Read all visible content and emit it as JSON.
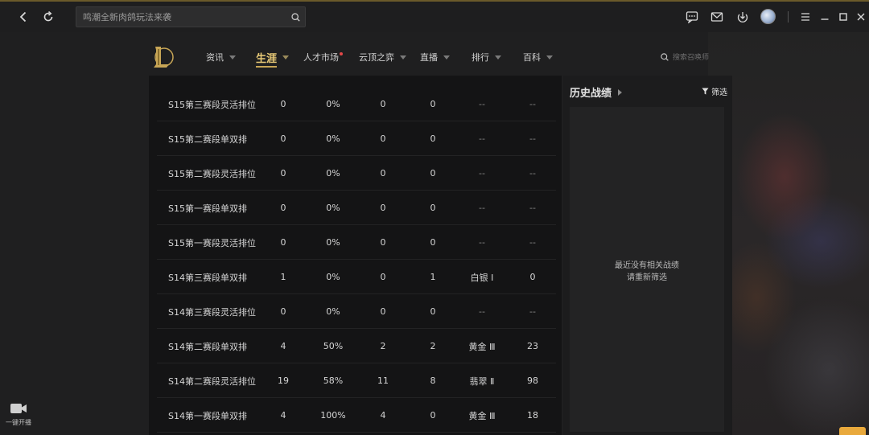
{
  "search": {
    "placeholder": "鸣潮全新肉鸽玩法来袭"
  },
  "nav": [
    {
      "label": "资讯",
      "has_caret": true,
      "active": false,
      "dot": false
    },
    {
      "label": "生涯",
      "has_caret": true,
      "active": true,
      "dot": false
    },
    {
      "label": "人才市场",
      "has_caret": false,
      "active": false,
      "dot": true
    },
    {
      "label": "云顶之弈",
      "has_caret": true,
      "active": false,
      "dot": false
    },
    {
      "label": "直播",
      "has_caret": true,
      "active": false,
      "dot": false
    },
    {
      "label": "排行",
      "has_caret": true,
      "active": false,
      "dot": false
    },
    {
      "label": "百科",
      "has_caret": true,
      "active": false,
      "dot": false
    }
  ],
  "summoner_search": {
    "placeholder": "搜索召唤师"
  },
  "table": {
    "rows": [
      [
        "S15第三赛段灵活排位",
        "0",
        "0%",
        "0",
        "0",
        "--",
        "--"
      ],
      [
        "S15第二赛段单双排",
        "0",
        "0%",
        "0",
        "0",
        "--",
        "--"
      ],
      [
        "S15第二赛段灵活排位",
        "0",
        "0%",
        "0",
        "0",
        "--",
        "--"
      ],
      [
        "S15第一赛段单双排",
        "0",
        "0%",
        "0",
        "0",
        "--",
        "--"
      ],
      [
        "S15第一赛段灵活排位",
        "0",
        "0%",
        "0",
        "0",
        "--",
        "--"
      ],
      [
        "S14第三赛段单双排",
        "1",
        "0%",
        "0",
        "1",
        "白银 Ⅰ",
        "0"
      ],
      [
        "S14第三赛段灵活排位",
        "0",
        "0%",
        "0",
        "0",
        "--",
        "--"
      ],
      [
        "S14第二赛段单双排",
        "4",
        "50%",
        "2",
        "2",
        "黄金 Ⅲ",
        "23"
      ],
      [
        "S14第二赛段灵活排位",
        "19",
        "58%",
        "11",
        "8",
        "翡翠 Ⅱ",
        "98"
      ],
      [
        "S14第一赛段单双排",
        "4",
        "100%",
        "4",
        "0",
        "黄金 Ⅲ",
        "18"
      ]
    ]
  },
  "history": {
    "title": "历史战绩",
    "filter_label": "筛选",
    "empty_line1": "最近没有相关战绩",
    "empty_line2": "请重新筛选"
  },
  "live_button": {
    "label": "一键开播"
  },
  "colors": {
    "accent_gold": "#c8a656",
    "active_nav": "#e7c977",
    "corner_button": "#e9a93c",
    "nav_dot": "#e34848"
  },
  "icons": [
    "back-icon",
    "refresh-icon",
    "search-icon",
    "chat-icon",
    "mail-icon",
    "download-icon",
    "menu-icon",
    "minimize-icon",
    "maximize-icon",
    "close-icon",
    "camera-icon",
    "filter-icon",
    "lol-logo"
  ]
}
